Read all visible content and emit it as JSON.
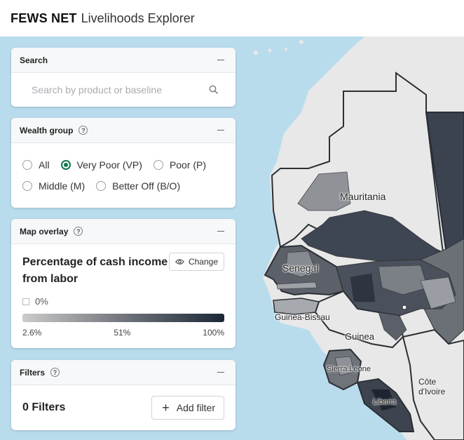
{
  "header": {
    "brand_bold": "FEWS NET",
    "brand_light": "Livelihoods Explorer"
  },
  "search": {
    "title": "Search",
    "placeholder": "Search by product or baseline",
    "collapse_icon": "minus-icon",
    "search_icon": "magnifier-icon"
  },
  "wealth_group": {
    "title": "Wealth group",
    "help_icon": "question-circle-icon",
    "selected": "Very Poor (VP)",
    "options": [
      {
        "label": "All",
        "checked": false
      },
      {
        "label": "Very Poor (VP)",
        "checked": true
      },
      {
        "label": "Poor (P)",
        "checked": false
      },
      {
        "label": "Middle (M)",
        "checked": false
      },
      {
        "label": "Better Off (B/O)",
        "checked": false
      }
    ],
    "accent_color": "#0e7a4b"
  },
  "map_overlay": {
    "title": "Map overlay",
    "metric": "Percentage of cash income from labor",
    "change_label": "Change",
    "change_icon": "eye-icon",
    "zero_label": "0%",
    "legend": {
      "min": "2.6%",
      "mid": "51%",
      "max": "100%"
    },
    "colors": {
      "low": "#cbcbcb",
      "mid": "#7a7d83",
      "high": "#1b2736"
    }
  },
  "filters": {
    "title": "Filters",
    "count_label": "0 Filters",
    "add_label": "Add filter"
  },
  "map": {
    "labels": [
      "Mauritania",
      "Senegal",
      "Guinea-Bissau",
      "Guinea",
      "Sierra Leone",
      "Liberia",
      "Côte d'Ivoire"
    ],
    "ocean_color": "#b9dced",
    "land_color": "#e8e8e8"
  }
}
